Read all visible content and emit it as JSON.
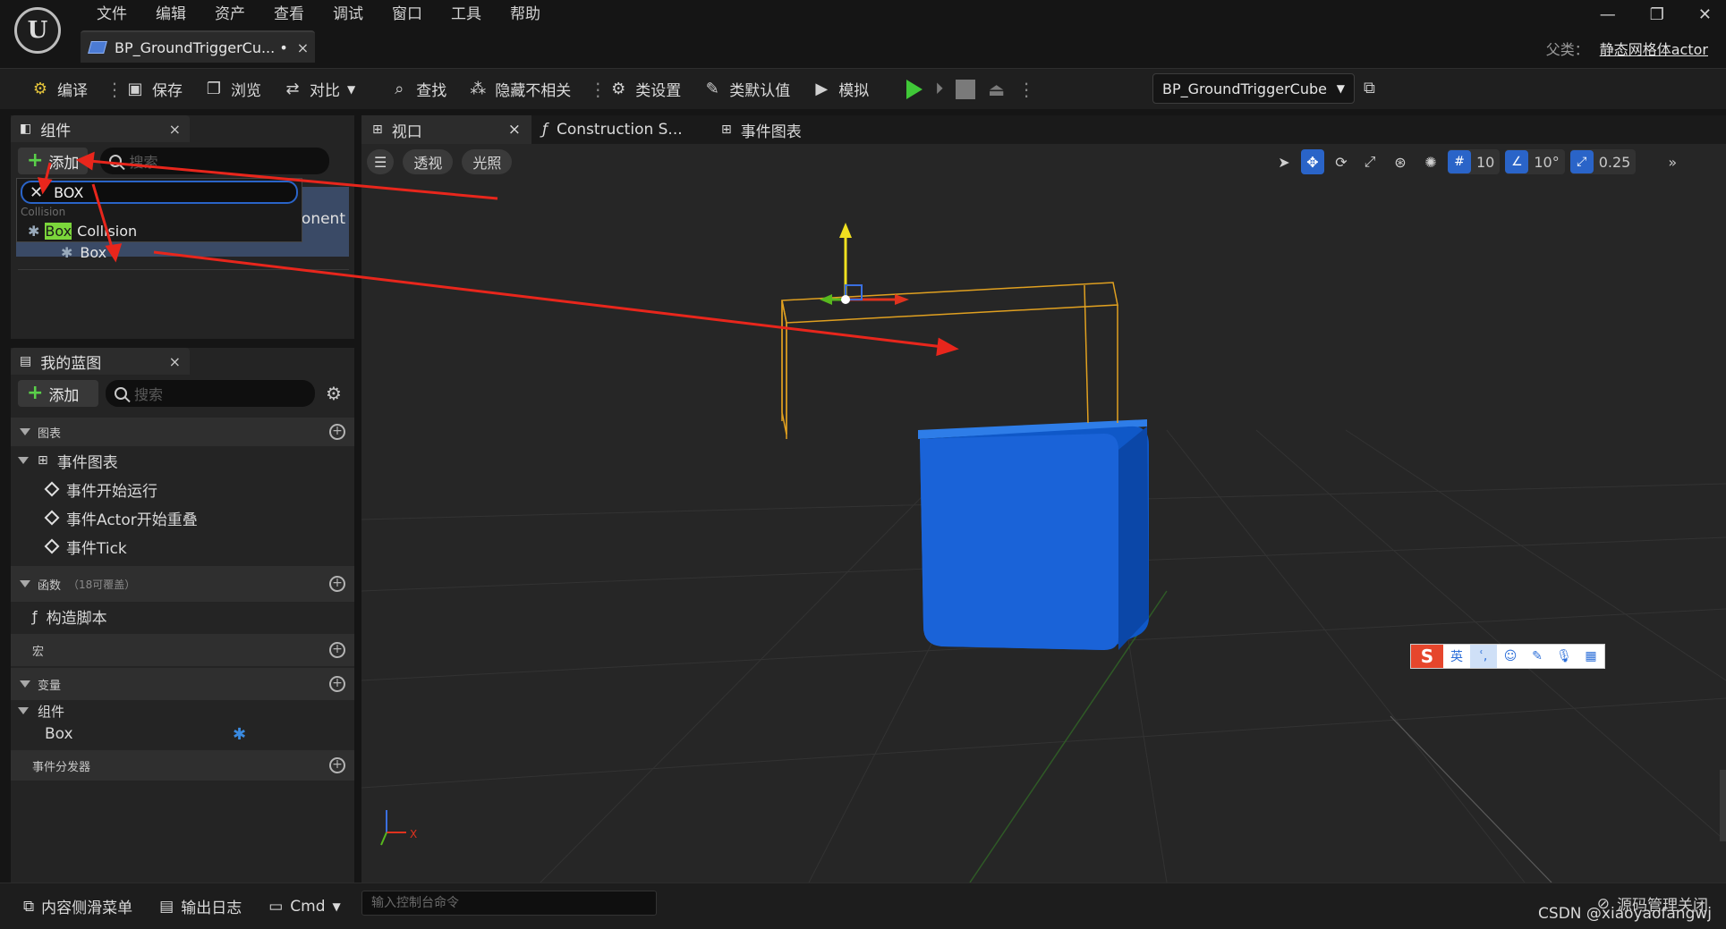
{
  "app": {
    "logo_text": "U"
  },
  "menu": [
    "文件",
    "编辑",
    "资产",
    "查看",
    "调试",
    "窗口",
    "工具",
    "帮助"
  ],
  "document_tab": {
    "label": "BP_GroundTriggerCu... •",
    "close": "×"
  },
  "window_controls": {
    "minimize": "—",
    "restore": "❐",
    "close": "✕"
  },
  "parent_class": {
    "label": "父类：",
    "value": "静态网格体actor"
  },
  "toolbar": {
    "compile": "编译",
    "save": "保存",
    "browse": "浏览",
    "diff": "对比",
    "find": "查找",
    "hide_unrelated": "隐藏不相关",
    "class_settings": "类设置",
    "class_defaults": "类默认值",
    "simulate": "模拟",
    "debug_object": "BP_GroundTriggerCube"
  },
  "components_panel": {
    "tab_label": "组件",
    "close": "×",
    "add_label": "添加",
    "search_placeholder": "搜索",
    "filter_text": "BOX",
    "category": "Collision",
    "result_prefix": "Box",
    "result_suffix": " Collision",
    "behind_text": "ponent",
    "child_item": "Box"
  },
  "my_blueprint": {
    "tab_label": "我的蓝图",
    "close": "×",
    "add_label": "添加",
    "search_placeholder": "搜索",
    "sections": {
      "graphs": "图表",
      "event_graph": "事件图表",
      "events": [
        "事件开始运行",
        "事件Actor开始重叠",
        "事件Tick"
      ],
      "functions": "函数",
      "functions_note": "（18可覆盖）",
      "construction_script": "构造脚本",
      "macros": "宏",
      "variables": "变量",
      "components_group": "组件",
      "variable_box": "Box",
      "dispatchers": "事件分发器"
    }
  },
  "viewport_tabs": [
    "视口",
    "Construction S...",
    "事件图表"
  ],
  "viewport_tab_close": "×",
  "viewport": {
    "view_mode": "透视",
    "lighting": "光照",
    "grid_snap": "10",
    "rot_snap": "10°",
    "scale_snap": "0.25"
  },
  "bottom_bar": {
    "content_drawer": "内容侧滑菜单",
    "output_log": "输出日志",
    "cmd": "Cmd",
    "console_placeholder": "输入控制台命令",
    "source_control": "源码管理关闭"
  },
  "ime": {
    "lang": "英"
  },
  "watermark": "CSDN @xiaoyaofangwj",
  "colors": {
    "accent_blue": "#2a64c8",
    "play_green": "#40c838",
    "annotation_red": "#e8261c",
    "cube_blue": "#1560d8",
    "highlight_green": "#7bd63b"
  }
}
